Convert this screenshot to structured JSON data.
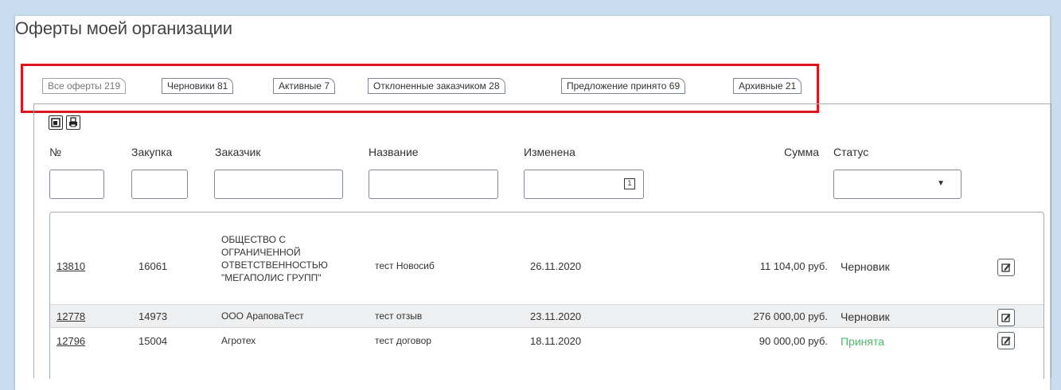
{
  "page": {
    "title": "Оферты моей организации"
  },
  "tabs": [
    {
      "label": "Все оферты 219",
      "active": true
    },
    {
      "label": "Черновики 81"
    },
    {
      "label": "Активные 7"
    },
    {
      "label": "Отклоненные заказчиком 28"
    },
    {
      "label": "Предложение принято 69"
    },
    {
      "label": "Архивные 21"
    }
  ],
  "toolbar": {
    "icons": [
      "export-excel-icon",
      "print-icon"
    ]
  },
  "columns": {
    "number": "№",
    "purchase": "Закупка",
    "customer": "Заказчик",
    "name": "Название",
    "modified": "Изменена",
    "amount": "Сумма",
    "status": "Статус"
  },
  "filters": {
    "modified_icon": "calendar-icon",
    "status_icon": "dropdown-caret-icon"
  },
  "rows": [
    {
      "number": "13810",
      "purchase": "16061",
      "customer": "ОБЩЕСТВО С ОГРАНИЧЕННОЙ ОТВЕТСТВЕННОСТЬЮ \"МЕГАПОЛИС ГРУПП\"",
      "name": "тест Новосиб",
      "modified": "26.11.2020",
      "amount": "11 104,00 руб.",
      "status": "Черновик"
    },
    {
      "number": "12778",
      "purchase": "14973",
      "customer": "ООО АраповаТест",
      "name": "тест отзыв",
      "modified": "23.11.2020",
      "amount": "276 000,00 руб.",
      "status": "Черновик"
    },
    {
      "number": "12796",
      "purchase": "15004",
      "customer": "Агротех",
      "name": "тест договор",
      "modified": "18.11.2020",
      "amount": "90 000,00 руб.",
      "status": "Принята"
    }
  ],
  "colors": {
    "highlight": "#e0141e",
    "status_accepted": "#4cba6f",
    "background": "#c9ddf1"
  }
}
